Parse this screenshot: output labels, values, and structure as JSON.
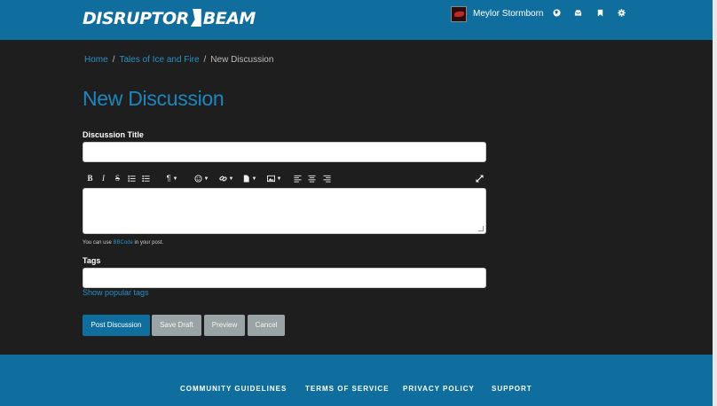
{
  "header": {
    "logo_left": "DISRUPTOR",
    "logo_right": "BEAM",
    "username": "Meylor Stormborn",
    "icons": [
      "globe-icon",
      "inbox-icon",
      "bookmark-icon",
      "gear-icon"
    ]
  },
  "breadcrumb": {
    "items": [
      "Home",
      "Tales of Ice and Fire",
      "New Discussion"
    ],
    "separator": "/"
  },
  "page_title": "New Discussion",
  "form": {
    "title_label": "Discussion Title",
    "title_value": "",
    "body_value": "",
    "hint_prefix": "You can use ",
    "hint_link": "BBCode",
    "hint_suffix": " in your post.",
    "tags_label": "Tags",
    "tags_value": "",
    "show_popular_tags": "Show popular tags"
  },
  "toolbar": {
    "bold": "B",
    "italic": "I",
    "strike": "S",
    "paragraph": "¶"
  },
  "buttons": {
    "post": "Post Discussion",
    "save_draft": "Save Draft",
    "preview": "Preview",
    "cancel": "Cancel"
  },
  "footer": {
    "links": [
      "COMMUNITY GUIDELINES",
      "TERMS OF SERVICE",
      "PRIVACY POLICY",
      "SUPPORT"
    ]
  },
  "colors": {
    "brand": "#0f6e9e",
    "link": "#2a8fc4",
    "background": "#1e1e1f"
  }
}
